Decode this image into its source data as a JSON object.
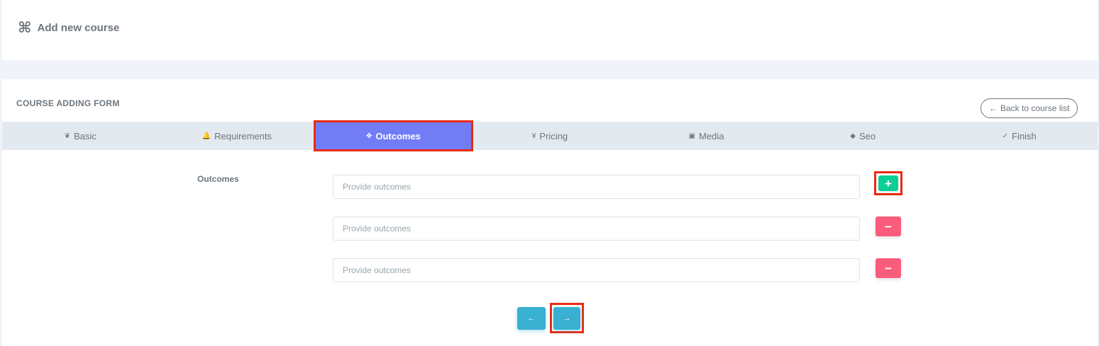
{
  "header": {
    "icon": "command-icon",
    "title": "Add new course"
  },
  "form": {
    "heading": "COURSE ADDING FORM",
    "back_button": "Back to course list",
    "back_icon": "←"
  },
  "tabs": [
    {
      "label": "Basic",
      "icon": "leaf-icon",
      "glyph": "❦",
      "active": false
    },
    {
      "label": "Requirements",
      "icon": "bell-icon",
      "glyph": "🔔",
      "active": false
    },
    {
      "label": "Outcomes",
      "icon": "move-icon",
      "glyph": "✥",
      "active": true
    },
    {
      "label": "Pricing",
      "icon": "yen-icon",
      "glyph": "¥",
      "active": false
    },
    {
      "label": "Media",
      "icon": "media-icon",
      "glyph": "▣",
      "active": false
    },
    {
      "label": "Seo",
      "icon": "tag-icon",
      "glyph": "◆",
      "active": false
    },
    {
      "label": "Finish",
      "icon": "check-circle-icon",
      "glyph": "✓",
      "active": false
    }
  ],
  "outcomes": {
    "label": "Outcomes",
    "placeholder": "Provide outcomes",
    "rows": [
      {
        "value": "",
        "button": "+",
        "button_type": "add"
      },
      {
        "value": "",
        "button": "−",
        "button_type": "remove"
      },
      {
        "value": "",
        "button": "−",
        "button_type": "remove"
      }
    ]
  },
  "navigation": {
    "prev_glyph": "←",
    "next_glyph": "→"
  },
  "colors": {
    "accent": "#727cf5",
    "add": "#0acf97",
    "remove": "#fa5c7c",
    "nav": "#39afd1",
    "highlight": "#ea2a14"
  }
}
